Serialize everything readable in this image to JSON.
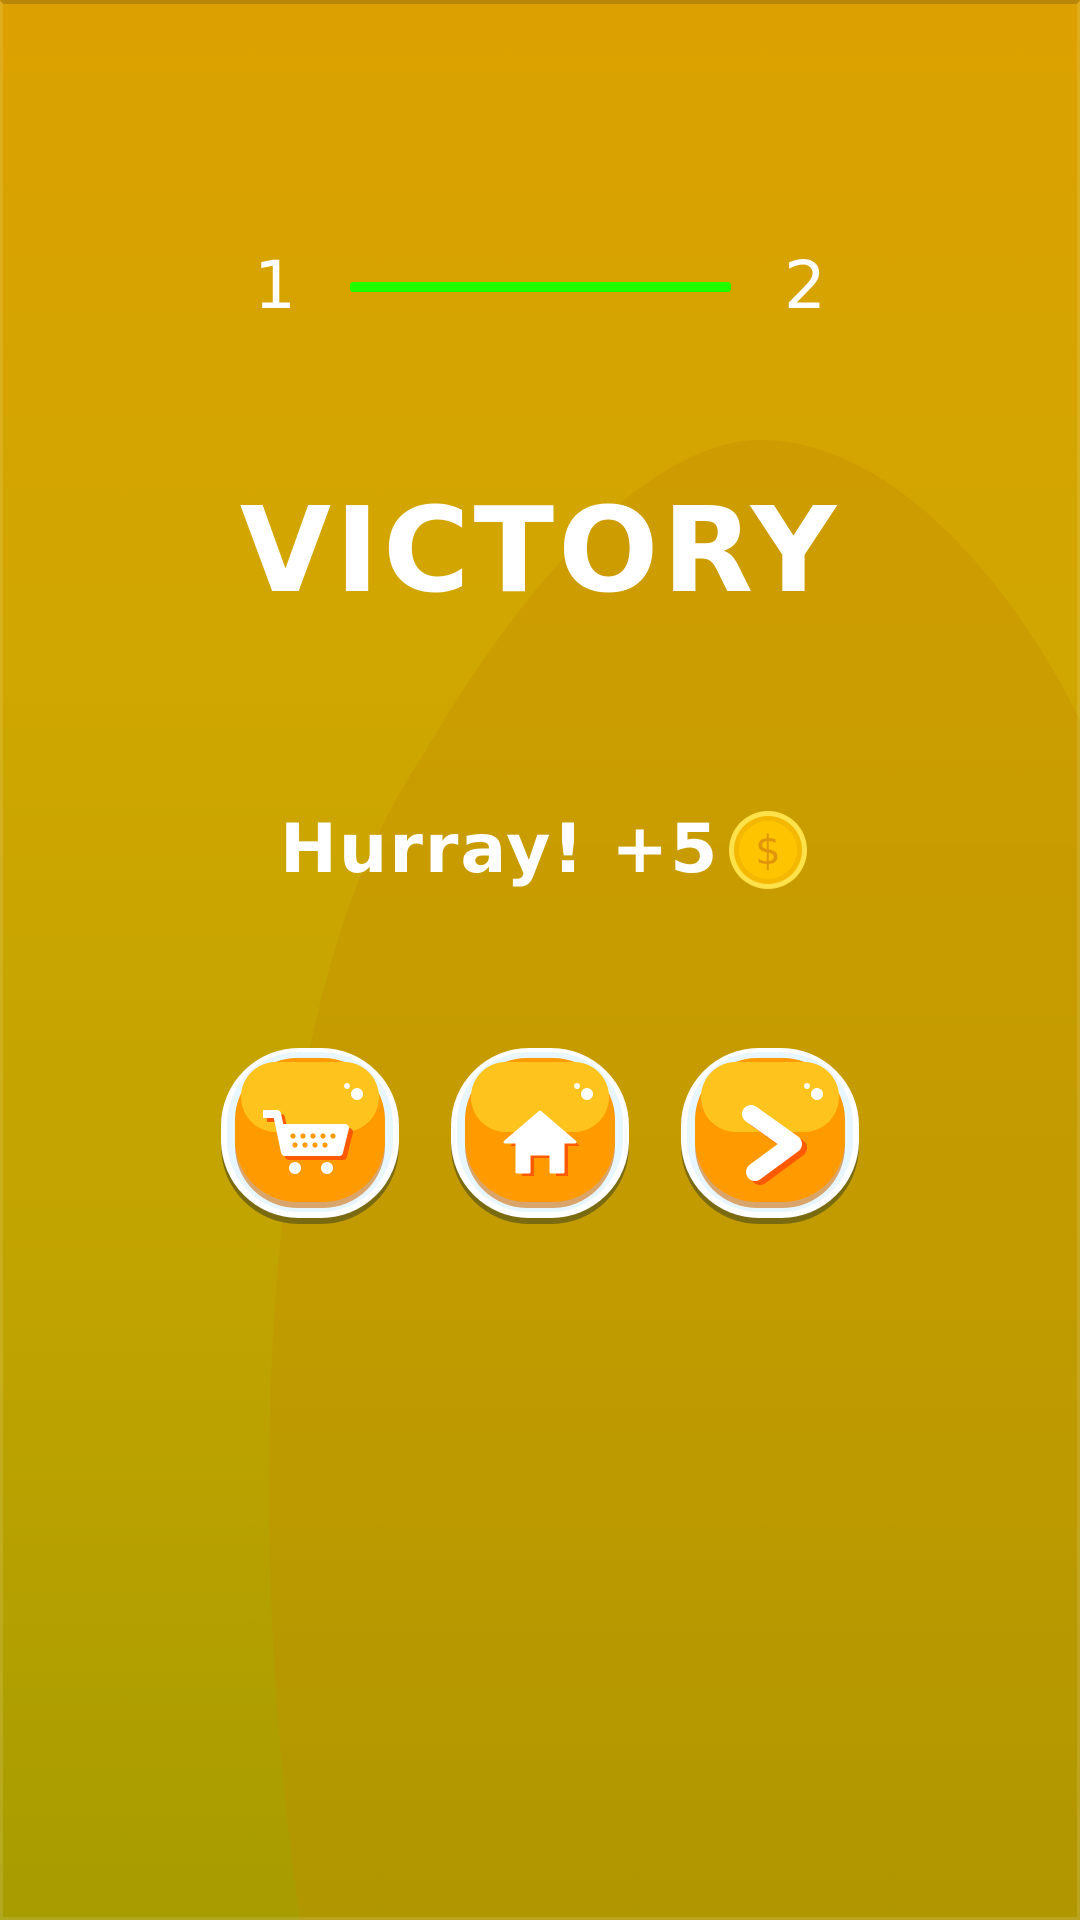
{
  "level": {
    "current": "1",
    "next": "2",
    "progress": 1.0,
    "progress_color": "#1fff00"
  },
  "title": "VICTORY",
  "reward": {
    "text": "Hurray! +5",
    "coin_icon": "coin-icon"
  },
  "buttons": [
    {
      "name": "shop-button",
      "icon": "shopping-cart-icon"
    },
    {
      "name": "home-button",
      "icon": "home-icon"
    },
    {
      "name": "next-button",
      "icon": "chevron-right-icon"
    }
  ],
  "colors": {
    "background_top": "#dca100",
    "background_bottom": "#a79c00",
    "button_orange": "#ff9a00",
    "button_rim": "#ffffff",
    "coin_gold": "#f7c400"
  }
}
